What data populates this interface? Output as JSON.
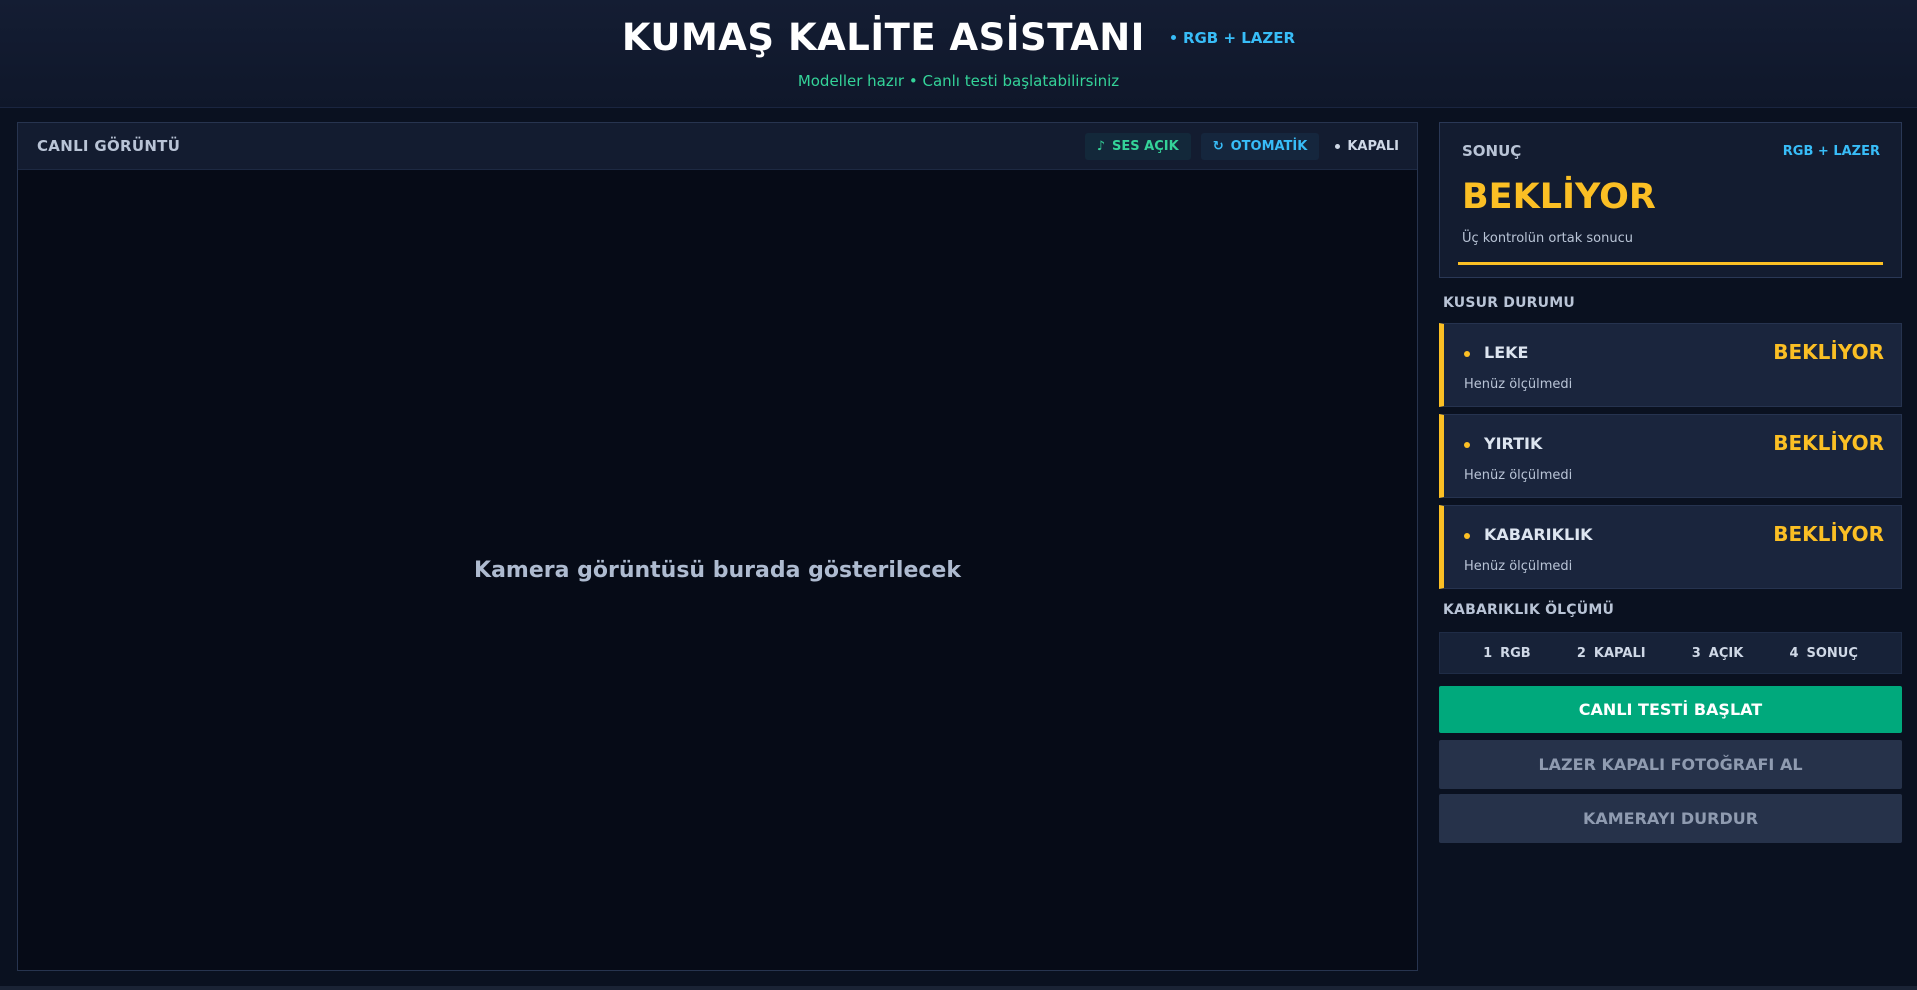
{
  "header": {
    "title": "KUMAŞ KALİTE ASİSTANI",
    "mode_badge": "RGB + LAZER",
    "status": "Modeller hazır • Canlı testi başlatabilirsiniz"
  },
  "camera": {
    "title": "CANLI GÖRÜNTÜ",
    "sound_label": "SES AÇIK",
    "auto_label": "OTOMATİK",
    "laser_label": "KAPALI",
    "placeholder": "Kamera görüntüsü burada gösterilecek"
  },
  "result": {
    "label": "SONUÇ",
    "mode": "RGB + LAZER",
    "value": "BEKLİYOR",
    "subtitle": "Üç kontrolün ortak sonucu"
  },
  "defects": {
    "title": "KUSUR DURUMU",
    "items": [
      {
        "name": "LEKE",
        "state": "BEKLİYOR",
        "note": "Henüz ölçülmedi"
      },
      {
        "name": "YIRTIK",
        "state": "BEKLİYOR",
        "note": "Henüz ölçülmedi"
      },
      {
        "name": "KABARIKLIK",
        "state": "BEKLİYOR",
        "note": "Henüz ölçülmedi"
      }
    ]
  },
  "measurement": {
    "title": "KABARIKLIK ÖLÇÜMÜ",
    "steps": [
      {
        "num": "1",
        "label": "RGB"
      },
      {
        "num": "2",
        "label": "KAPALI"
      },
      {
        "num": "3",
        "label": "AÇIK"
      },
      {
        "num": "4",
        "label": "SONUÇ"
      }
    ]
  },
  "actions": {
    "start_label": "CANLI TESTİ BAŞLAT",
    "laser_off_label": "LAZER KAPALI FOTOĞRAFI AL",
    "stop_label": "KAMERAYI DURDUR"
  },
  "colors": {
    "accent_green": "#00a97c",
    "pending_yellow": "#fbbf24",
    "info_blue": "#38bdf8",
    "status_green": "#34d399"
  },
  "icons": {
    "sound": "music-note-icon",
    "auto": "refresh-icon",
    "laser": "dot-icon"
  }
}
